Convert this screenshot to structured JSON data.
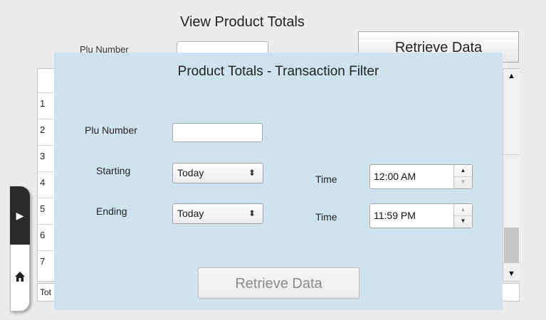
{
  "page": {
    "title": "View Product Totals",
    "plu_label": "Plu Number",
    "retrieve_label": "Retrieve Data",
    "table_rows": [
      "1",
      "2",
      "3",
      "4",
      "5",
      "6",
      "7"
    ],
    "totals_label": "Tot"
  },
  "side_tab": {
    "expand_icon": "play-arrow-icon",
    "home_icon": "home-icon"
  },
  "modal": {
    "title": "Product Totals - Transaction Filter",
    "plu_label": "Plu Number",
    "plu_value": "",
    "starting_label": "Starting",
    "starting_value": "Today",
    "ending_label": "Ending",
    "ending_value": "Today",
    "time_label": "Time",
    "start_time": "12:00 AM",
    "end_time": "11:59 PM",
    "retrieve_label": "Retrieve Data"
  },
  "colors": {
    "modal_background": "#cfe3ee",
    "disabled_text": "#8a8a8a"
  }
}
